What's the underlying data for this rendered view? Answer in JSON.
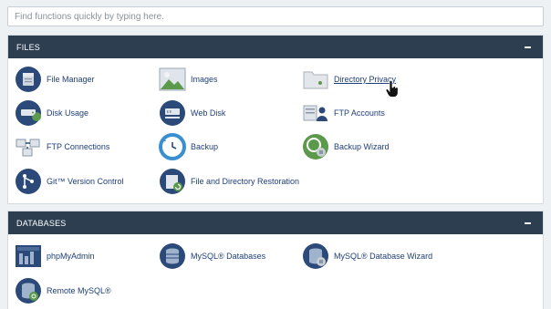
{
  "search": {
    "placeholder": "Find functions quickly by typing here."
  },
  "files": {
    "title": "FILES",
    "items": [
      {
        "label": "File Manager",
        "icon": "file-manager-icon"
      },
      {
        "label": "Images",
        "icon": "images-icon"
      },
      {
        "label": "Directory Privacy",
        "icon": "directory-privacy-icon"
      },
      {
        "label": "Disk Usage",
        "icon": "disk-usage-icon"
      },
      {
        "label": "Web Disk",
        "icon": "web-disk-icon"
      },
      {
        "label": "FTP Accounts",
        "icon": "ftp-accounts-icon"
      },
      {
        "label": "FTP Connections",
        "icon": "ftp-connections-icon"
      },
      {
        "label": "Backup",
        "icon": "backup-icon"
      },
      {
        "label": "Backup Wizard",
        "icon": "backup-wizard-icon"
      },
      {
        "label": "Git™ Version Control",
        "icon": "git-icon"
      },
      {
        "label": "File and Directory Restoration",
        "icon": "restoration-icon"
      }
    ]
  },
  "databases": {
    "title": "DATABASES",
    "items": [
      {
        "label": "phpMyAdmin",
        "icon": "phpmyadmin-icon"
      },
      {
        "label": "MySQL® Databases",
        "icon": "mysql-databases-icon"
      },
      {
        "label": "MySQL® Database Wizard",
        "icon": "mysql-wizard-icon"
      },
      {
        "label": "Remote MySQL®",
        "icon": "remote-mysql-icon"
      }
    ]
  },
  "colors": {
    "header_bg": "#2c3e50",
    "link": "#1f3f7a",
    "icon_navy": "#2b4a7a",
    "icon_green": "#5a9a4a",
    "icon_blue": "#3a8fd0"
  }
}
